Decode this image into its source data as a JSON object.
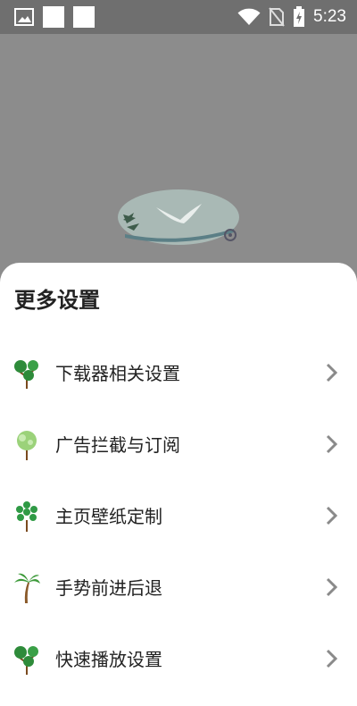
{
  "status_bar": {
    "time": "5:23",
    "icons": [
      "image-icon",
      "square-icon",
      "square-icon",
      "wifi-icon",
      "no-sim-icon",
      "battery-charging-icon"
    ]
  },
  "sheet": {
    "title": "更多设置",
    "items": [
      {
        "label": "下载器相关设置",
        "icon": "tree-icon"
      },
      {
        "label": "广告拦截与订阅",
        "icon": "tree-icon"
      },
      {
        "label": "主页壁纸定制",
        "icon": "tree-icon"
      },
      {
        "label": "手势前进后退",
        "icon": "palm-tree-icon"
      },
      {
        "label": "快速播放设置",
        "icon": "tree-icon"
      }
    ]
  },
  "colors": {
    "scrim": "#8c8c8c",
    "statusbar": "#6f6f6f",
    "sheet_bg": "#ffffff",
    "text": "#222222",
    "chevron": "#8a8a8a",
    "leaf_green": "#2e8b3a",
    "trunk_brown": "#7a4a1e"
  }
}
